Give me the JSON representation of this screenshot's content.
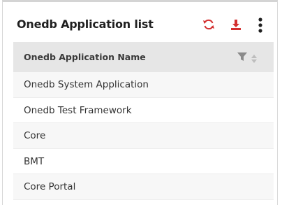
{
  "header": {
    "title": "Onedb Application list"
  },
  "icons": {
    "refresh": "refresh-icon",
    "download": "download-icon",
    "more": "more-vertical-icon",
    "filter": "filter-icon",
    "sort": "sort-icon"
  },
  "colors": {
    "accent": "#d32f2f",
    "header_bg": "#e6e6e6"
  },
  "table": {
    "columns": [
      {
        "label": "Onedb Application Name"
      }
    ],
    "rows": [
      "Onedb System Application",
      "Onedb Test Framework",
      "Core",
      "BMT",
      "Core Portal"
    ]
  }
}
